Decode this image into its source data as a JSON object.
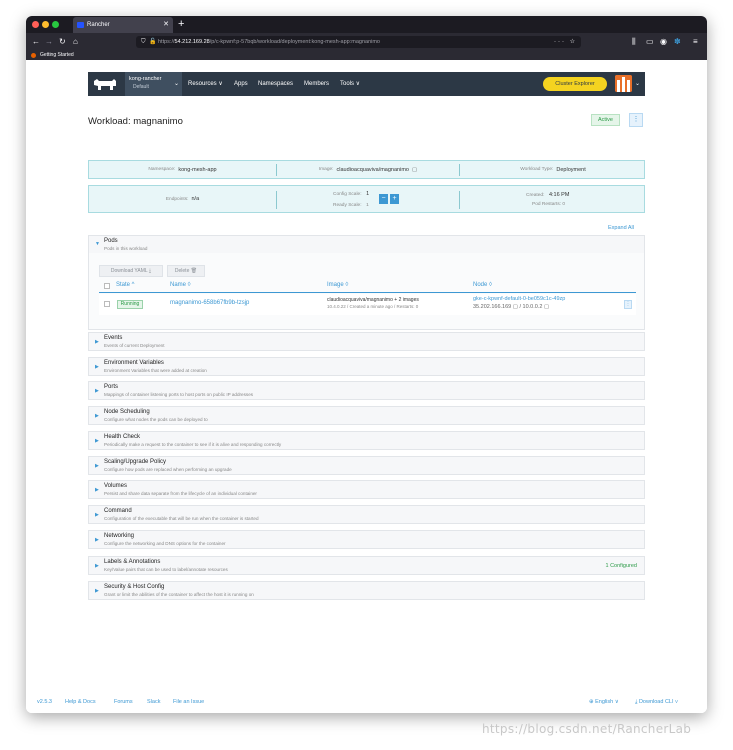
{
  "browser": {
    "tab_title": "Rancher",
    "new_tab": "+",
    "url_host": "54.212.169.28",
    "url_prefix": "https://",
    "url_path": "/p/c-kpwnf:p-57bqb/workload/deployment:kong-mesh-app:magnanimo",
    "bookmark": "Getting Started",
    "url_tools": "··· ☆"
  },
  "header": {
    "cluster_name": "kong-rancher",
    "cluster_sub": "Default",
    "menu": [
      "Resources ∨",
      "Apps",
      "Namespaces",
      "Members",
      "Tools ∨"
    ],
    "cluster_explorer": "Cluster Explorer"
  },
  "workload": {
    "title": "Workload: magnanimo",
    "status": "Active",
    "namespace_label": "Namespace:",
    "namespace": "kong-mesh-app",
    "image_label": "Image:",
    "image": "claudioacquaviva/magnanimo",
    "type_label": "Workload Type:",
    "type": "Deployment",
    "endpoints_label": "Endpoints:",
    "endpoints": "n/a",
    "config_scale_label": "Config Scale:",
    "config_scale": "1",
    "ready_scale_label": "Ready Scale:",
    "ready_scale": "1",
    "created_label": "Created:",
    "created": "4:16 PM",
    "pod_restarts": "Pod Restarts: 0",
    "scale_down": "−",
    "scale_up": "+"
  },
  "expand_all": "Expand All",
  "pods": {
    "title": "Pods",
    "desc": "Pods in this workload",
    "download_yaml": "Download YAML ⤓",
    "delete": "Delete 🗑",
    "col_state": "State ^",
    "col_name": "Name ◊",
    "col_image": "Image ◊",
    "col_node": "Node ◊",
    "row": {
      "state": "Running",
      "name": "magnanimo-658b67fb9b-tzsjp",
      "image": "claudioacquaviva/magnanimo + 2 images",
      "image_meta": "10.4.0.22 / Created a minute ago / Restarts: 0",
      "node": "gke-c-kpwnf-default-0-be059c1c-49zp",
      "node_ips": "35.202.166.169 ▢  /  10.0.0.2 ▢"
    }
  },
  "sections": [
    {
      "title": "Events",
      "desc": "Events of current Deployment",
      "extra": ""
    },
    {
      "title": "Environment Variables",
      "desc": "Environment Variables that were added at creation",
      "extra": ""
    },
    {
      "title": "Ports",
      "desc": "Mappings of container listening ports to host ports on public IP addresses",
      "extra": ""
    },
    {
      "title": "Node Scheduling",
      "desc": "Configure what nodes the pods can be deployed to",
      "extra": ""
    },
    {
      "title": "Health Check",
      "desc": "Periodically make a request to the container to see if it is alive and responding correctly",
      "extra": ""
    },
    {
      "title": "Scaling/Upgrade Policy",
      "desc": "Configure how pods are replaced when performing an upgrade",
      "extra": ""
    },
    {
      "title": "Volumes",
      "desc": "Persist and share data separate from the lifecycle of an individual container",
      "extra": ""
    },
    {
      "title": "Command",
      "desc": "Configuration of the executable that will be run when the container is started",
      "extra": ""
    },
    {
      "title": "Networking",
      "desc": "Configure the networking and DNS options for the container",
      "extra": ""
    },
    {
      "title": "Labels & Annotations",
      "desc": "Key/Value pairs that can be used to label/annotate resources",
      "extra": "1 Configured"
    },
    {
      "title": "Security & Host Config",
      "desc": "Grant or limit the abilities of the container to affect the host it is running on",
      "extra": ""
    }
  ],
  "footer": {
    "version": "v2.5.3",
    "links": [
      "Help & Docs",
      "Forums",
      "Slack",
      "File an Issue"
    ],
    "language": "⊕ English ∨",
    "download_cli": "⤓ Download CLI ∨"
  },
  "watermark": "https://blog.csdn.net/RancherLab"
}
